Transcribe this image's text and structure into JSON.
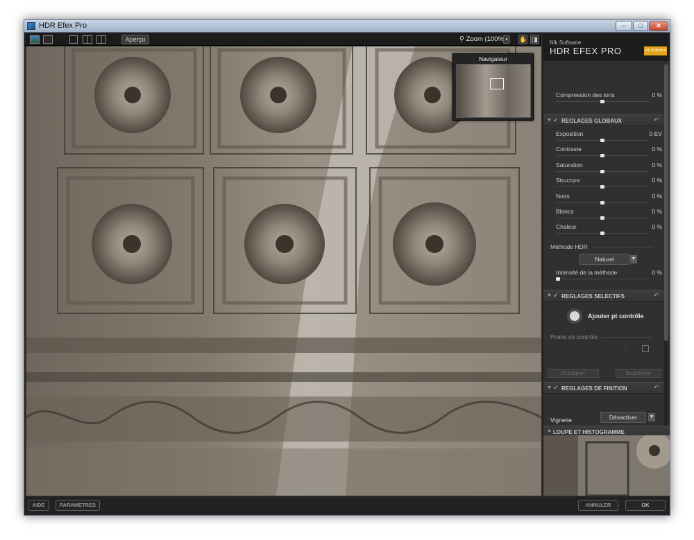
{
  "window": {
    "title": "HDR Efex Pro",
    "min": "–",
    "max": "□",
    "close": "✕"
  },
  "toolbar": {
    "preview_label": "Aperçu",
    "zoom_label": "Zoom (100%)"
  },
  "navigator": {
    "title": "Navigateur"
  },
  "panel": {
    "brand_small": "Nik Software",
    "brand_big": "HDR EFEX PRO",
    "logo_text": "nik Software",
    "tone_compression": {
      "label": "Compression des tons",
      "value": "0 %",
      "level": 0.5
    },
    "global": {
      "title": "REGLAGES GLOBAUX",
      "sliders": [
        {
          "label": "Exposition",
          "value": "0 EV",
          "level": 0.5
        },
        {
          "label": "Contraste",
          "value": "0 %",
          "level": 0.5
        },
        {
          "label": "Saturation",
          "value": "0 %",
          "level": 0.5
        },
        {
          "label": "Structure",
          "value": "0 %",
          "level": 0.5
        },
        {
          "label": "Noirs",
          "value": "0 %",
          "level": 0.5
        },
        {
          "label": "Blancs",
          "value": "0 %",
          "level": 0.5
        },
        {
          "label": "Chaleur",
          "value": "0 %",
          "level": 0.5
        }
      ],
      "method_label": "Méthode HDR",
      "method_value": "Naturel",
      "intensity": {
        "label": "Intensité de la méthode",
        "value": "0 %",
        "level": 0.02
      }
    },
    "selective": {
      "title": "REGLAGES SELECTIFS",
      "add_point_label": "Ajouter pt contrôle",
      "points_label": "Points de contrôle",
      "duplicate_label": "Dupliquer",
      "delete_label": "Supprimer"
    },
    "finishing": {
      "title": "REGLAGES DE FINITION",
      "vignette_label": "Vignette",
      "vignette_value": "Désactiver"
    },
    "loupe": {
      "title": "LOUPE ET HISTOGRAMME"
    }
  },
  "bottom": {
    "help": "AIDE",
    "settings": "PARAMETRES",
    "cancel": "ANNULER",
    "ok": "OK"
  },
  "colors": {
    "accent": "#e3a51a",
    "panel_bg": "#303030",
    "window_bg": "#2b2b2b"
  }
}
